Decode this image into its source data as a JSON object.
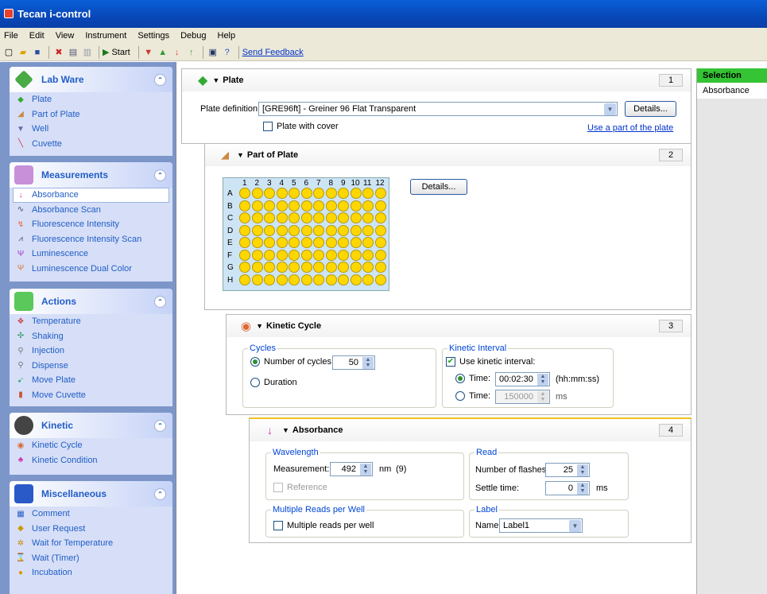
{
  "app": {
    "title": "Tecan i-control"
  },
  "menu": [
    "File",
    "Edit",
    "View",
    "Instrument",
    "Settings",
    "Debug",
    "Help"
  ],
  "toolbar": {
    "start_label": "Start",
    "feedback_label": "Send Feedback"
  },
  "panels": {
    "labware": {
      "title": "Lab Ware",
      "items": [
        "Plate",
        "Part of Plate",
        "Well",
        "Cuvette"
      ]
    },
    "measurements": {
      "title": "Measurements",
      "items": [
        "Absorbance",
        "Absorbance Scan",
        "Fluorescence Intensity",
        "Fluorescence Intensity Scan",
        "Luminescence",
        "Luminescence Dual Color"
      ]
    },
    "actions": {
      "title": "Actions",
      "items": [
        "Temperature",
        "Shaking",
        "Injection",
        "Dispense",
        "Move Plate",
        "Move Cuvette"
      ]
    },
    "kinetic": {
      "title": "Kinetic",
      "items": [
        "Kinetic Cycle",
        "Kinetic Condition"
      ]
    },
    "misc": {
      "title": "Miscellaneous",
      "items": [
        "Comment",
        "User Request",
        "Wait for Temperature",
        "Wait (Timer)",
        "Incubation"
      ]
    }
  },
  "plate_section": {
    "title": "Plate",
    "number": "1",
    "definition_label": "Plate definition:",
    "definition_value": "[GRE96ft] - Greiner 96 Flat Transparent",
    "details_label": "Details...",
    "cover_label": "Plate with cover",
    "use_part_link": "Use a part of the plate"
  },
  "part_section": {
    "title": "Part of Plate",
    "number": "2",
    "details_label": "Details...",
    "columns": [
      "1",
      "2",
      "3",
      "4",
      "5",
      "6",
      "7",
      "8",
      "9",
      "10",
      "11",
      "12"
    ],
    "rows": [
      "A",
      "B",
      "C",
      "D",
      "E",
      "F",
      "G",
      "H"
    ]
  },
  "kinetic_section": {
    "title": "Kinetic Cycle",
    "number": "3",
    "cycles_group": "Cycles",
    "num_cycles_label": "Number of cycles:",
    "num_cycles_value": "50",
    "duration_label": "Duration",
    "interval_group": "Kinetic Interval",
    "use_interval_label": "Use kinetic interval:",
    "time_label": "Time:",
    "time_value": "00:02:30",
    "time_unit": "(hh:mm:ss)",
    "time2_label": "Time:",
    "time2_value": "150000",
    "time2_unit": "ms"
  },
  "absorbance_section": {
    "title": "Absorbance",
    "number": "4",
    "wavelength_group": "Wavelength",
    "measurement_label": "Measurement:",
    "measurement_value": "492",
    "measurement_unit": "nm",
    "measurement_extra": "(9)",
    "reference_label": "Reference",
    "read_group": "Read",
    "flashes_label": "Number of flashes:",
    "flashes_value": "25",
    "settle_label": "Settle time:",
    "settle_value": "0",
    "settle_unit": "ms",
    "multi_group": "Multiple Reads per Well",
    "multi_label": "Multiple reads per well",
    "label_group": "Label",
    "name_label": "Name:",
    "name_value": "Label1"
  },
  "selection": {
    "title": "Selection",
    "items": [
      "Absorbance"
    ]
  }
}
